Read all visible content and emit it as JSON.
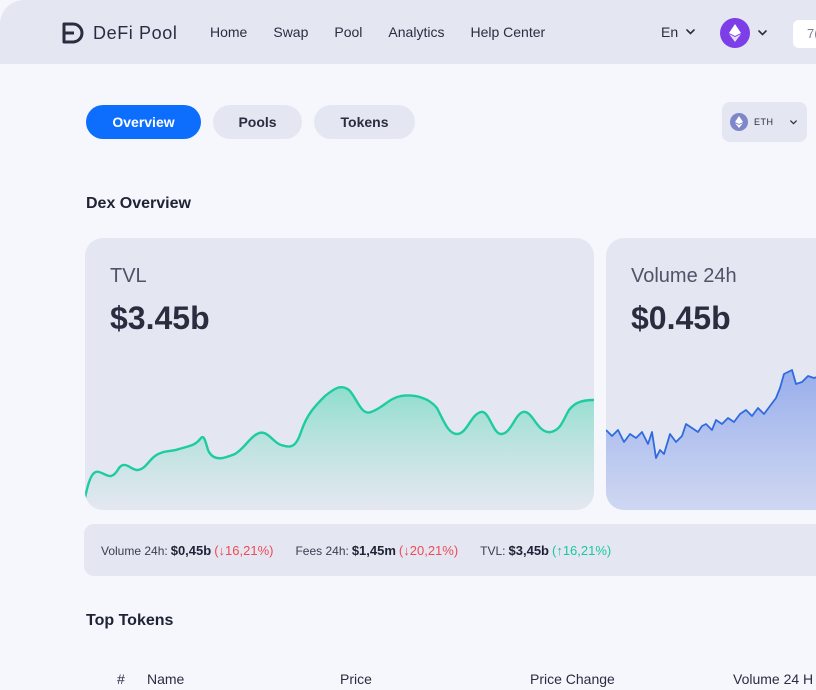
{
  "header": {
    "brand": "DeFi Pool",
    "nav": [
      "Home",
      "Swap",
      "Pool",
      "Analytics",
      "Help Center"
    ],
    "language": "En",
    "wallet_partial": "7("
  },
  "tabs": [
    {
      "label": "Overview",
      "active": true
    },
    {
      "label": "Pools",
      "active": false
    },
    {
      "label": "Tokens",
      "active": false
    }
  ],
  "network": {
    "label": "ETH",
    "icon": "ethereum-icon"
  },
  "dex_overview": {
    "title": "Dex Overview",
    "tvl": {
      "label": "TVL",
      "value": "$3.45b"
    },
    "volume": {
      "label": "Volume 24h",
      "value": "$0.45b"
    }
  },
  "stats": [
    {
      "label": "Volume 24h:",
      "value": "$0,45b",
      "change": "(↓16,21%)",
      "direction": "down"
    },
    {
      "label": "Fees 24h:",
      "value": "$1,45m",
      "change": "(↓20,21%)",
      "direction": "down"
    },
    {
      "label": "TVL:",
      "value": "$3,45b",
      "change": "(↑16,21%)",
      "direction": "up"
    }
  ],
  "top_tokens": {
    "title": "Top Tokens",
    "columns": [
      "#",
      "Name",
      "Price",
      "Price Change",
      "Volume 24 H"
    ]
  },
  "colors": {
    "accent": "#0d6efd",
    "tvl_line": "#1dcc9f",
    "volume_line": "#2e6be0",
    "down": "#ef4a55",
    "up": "#18c8a0",
    "eth_badge": "#7c3ee6"
  }
}
